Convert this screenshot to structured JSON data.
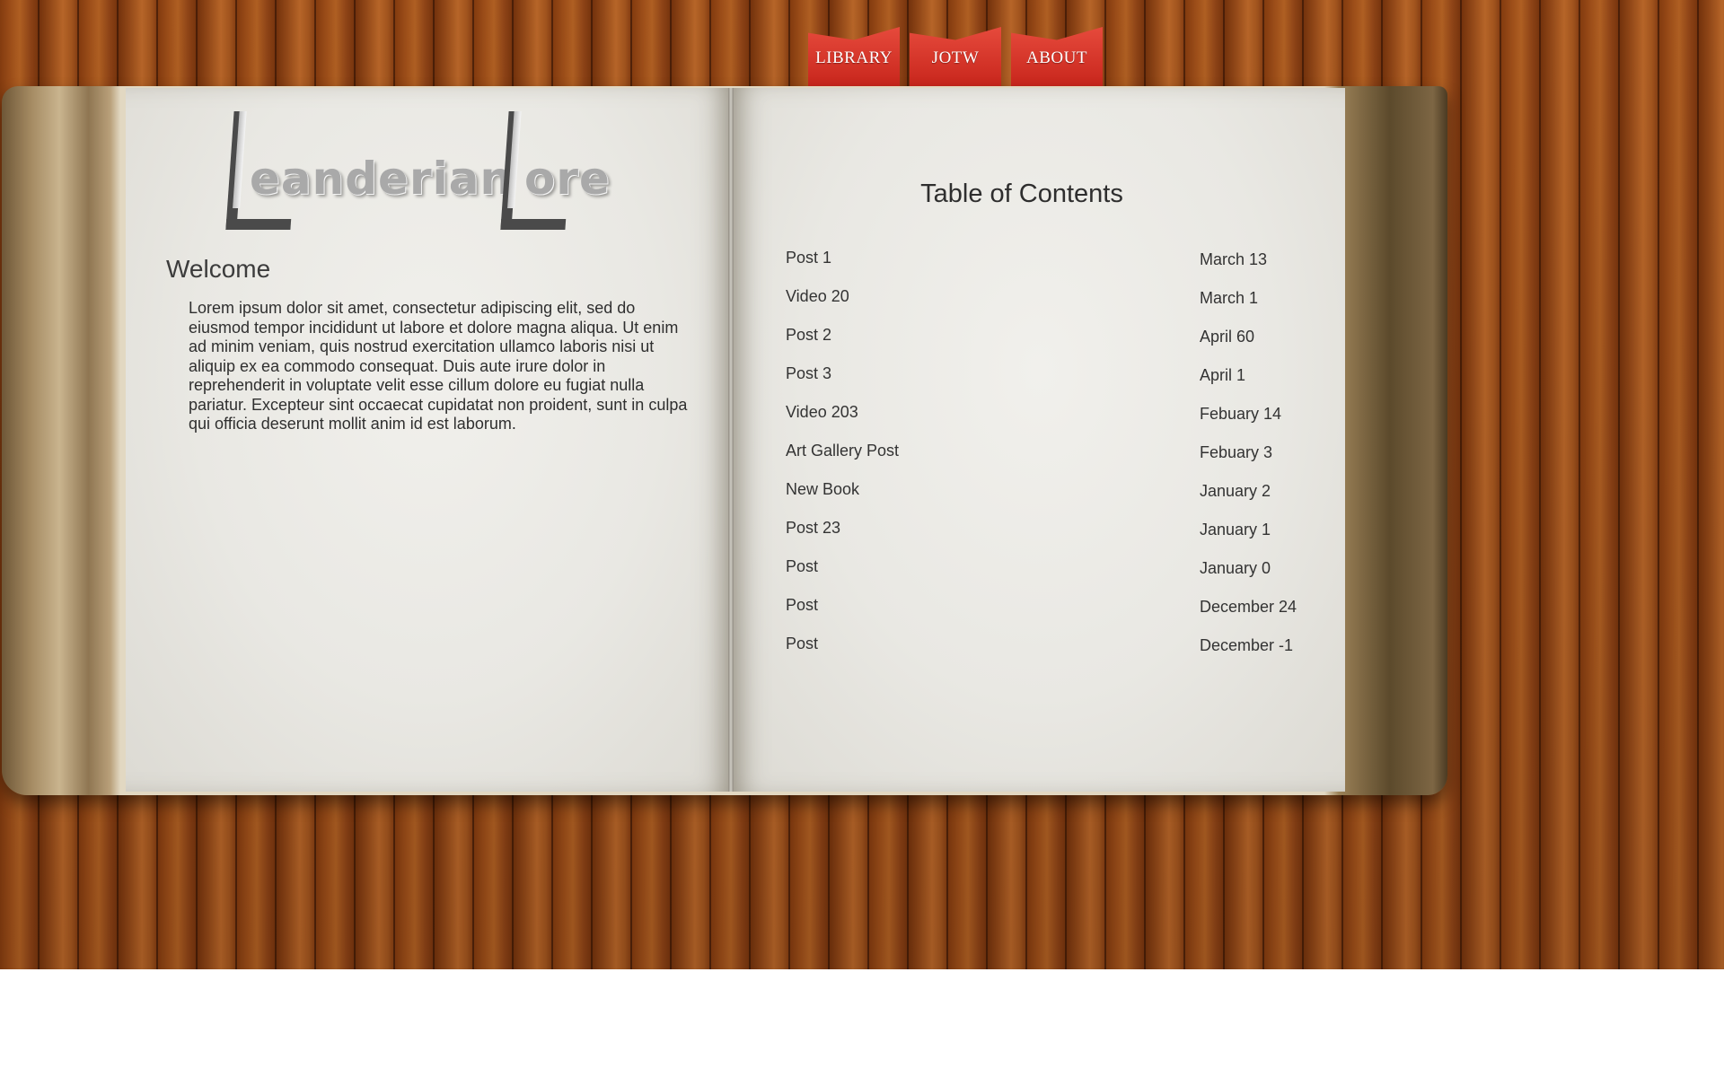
{
  "nav": {
    "tabs": [
      {
        "label": "LIBRARY"
      },
      {
        "label": "JOTW"
      },
      {
        "label": "ABOUT"
      }
    ]
  },
  "logo": {
    "initial_1": "L",
    "word_1": "eanderian",
    "initial_2": "L",
    "word_2": "ore"
  },
  "left_page": {
    "heading": "Welcome",
    "body": "Lorem ipsum dolor sit amet, consectetur adipiscing elit, sed do eiusmod tempor incididunt ut labore et dolore magna aliqua. Ut enim ad minim veniam, quis nostrud exercitation ullamco laboris nisi ut aliquip ex ea commodo consequat. Duis aute irure dolor in reprehenderit in voluptate velit esse cillum dolore eu fugiat nulla pariatur. Excepteur sint occaecat cupidatat non proident, sunt in culpa qui officia deserunt mollit anim id est laborum."
  },
  "right_page": {
    "heading": "Table of Contents",
    "entries": [
      {
        "title": "Post 1",
        "date": "March 13"
      },
      {
        "title": "Video 20",
        "date": "March 1"
      },
      {
        "title": "Post 2",
        "date": "April 60"
      },
      {
        "title": "Post 3",
        "date": "April 1"
      },
      {
        "title": "Video 203",
        "date": "Febuary 14"
      },
      {
        "title": "Art Gallery Post",
        "date": "Febuary 3"
      },
      {
        "title": "New Book",
        "date": "January 2"
      },
      {
        "title": "Post 23",
        "date": "January 1"
      },
      {
        "title": "Post",
        "date": "January 0"
      },
      {
        "title": "Post",
        "date": "December 24"
      },
      {
        "title": "Post",
        "date": "December -1"
      }
    ]
  },
  "colors": {
    "tab_red": "#d3362a",
    "wood": "#9a4c19",
    "page": "#ecebe6",
    "text": "#333333"
  }
}
